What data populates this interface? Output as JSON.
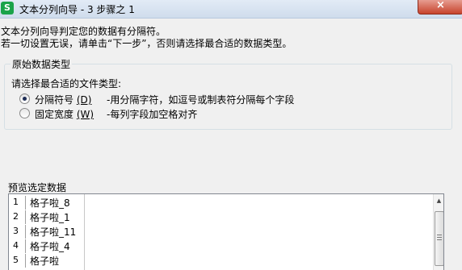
{
  "window": {
    "title": "文本分列向导 - 3 步骤之 1",
    "app_icon": "S",
    "close_glyph": "×"
  },
  "description": {
    "line1": "文本分列向导判定您的数据有分隔符。",
    "line2": "若一切设置无误，请单击“下一步”，否则请选择最合适的数据类型。"
  },
  "original_data_type": {
    "legend": "原始数据类型",
    "prompt": "请选择最合适的文件类型:",
    "options": [
      {
        "label": "分隔符号",
        "hotkey": "(D)",
        "description": "-用分隔字符，如逗号或制表符分隔每个字段",
        "selected": true
      },
      {
        "label": "固定宽度",
        "hotkey": "(W)",
        "description": "-每列字段加空格对齐",
        "selected": false
      }
    ]
  },
  "preview": {
    "label": "预览选定数据",
    "rows": [
      {
        "num": "1",
        "text": "格子啦_8"
      },
      {
        "num": "2",
        "text": "格子啦_1"
      },
      {
        "num": "3",
        "text": "格子啦_11"
      },
      {
        "num": "4",
        "text": "格子啦_4"
      },
      {
        "num": "5",
        "text": "格子啦"
      }
    ]
  },
  "colors": {
    "title_gradient_top": "#e2ebf6",
    "close_button": "#c7432c",
    "app_icon": "#1aa34a",
    "radio_dot": "#1f2d55"
  }
}
